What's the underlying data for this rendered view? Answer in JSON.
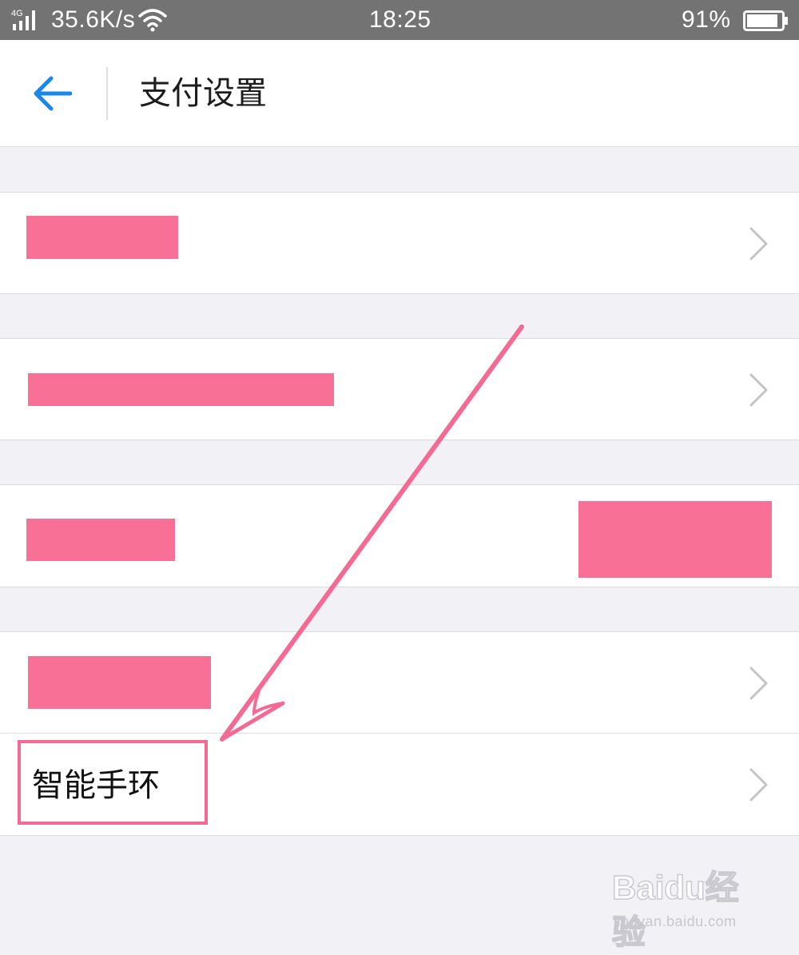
{
  "status_bar": {
    "network": "4G",
    "speed": "35.6K/s",
    "time": "18:25",
    "battery": "91%",
    "battery_level": 0.91,
    "icons": [
      "signal-icon",
      "wifi-icon",
      "battery-icon"
    ]
  },
  "header": {
    "back_icon": "arrow-left-icon",
    "title": "支付设置"
  },
  "list": {
    "rows": [
      {
        "label": "",
        "redacted": true,
        "chevron": true
      },
      {
        "label": "",
        "redacted": true,
        "chevron": true
      },
      {
        "label": "",
        "redacted": true,
        "value_redacted": true,
        "chevron": false
      },
      {
        "label": "",
        "redacted": true,
        "chevron": true
      },
      {
        "label": "智能手环",
        "redacted": false,
        "chevron": true
      }
    ]
  },
  "annotation": {
    "color": "#f36b95",
    "target": "智能手环"
  },
  "watermark": {
    "brand": "Baidu经验",
    "url": "jingyan.baidu.com"
  },
  "colors": {
    "accent": "#1a88e8",
    "redaction": "#f87096",
    "status_bar": "#737373",
    "background": "#f2f2f6"
  }
}
